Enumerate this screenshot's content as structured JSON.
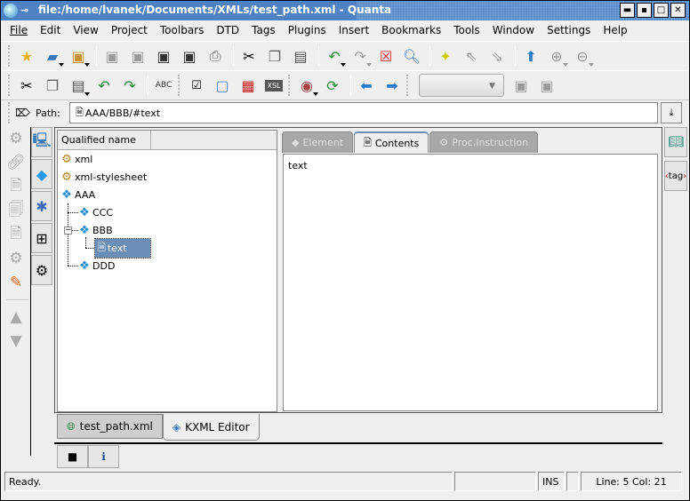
{
  "window": {
    "title": "file:/home/lvanek/Documents/XMLs/test_path.xml - Quanta",
    "buttons": [
      "minimize",
      "restore",
      "maximize",
      "close"
    ]
  },
  "menubar": {
    "items": [
      {
        "label": "File",
        "mnemonic": "F"
      },
      {
        "label": "Edit",
        "mnemonic": "E"
      },
      {
        "label": "View",
        "mnemonic": "V"
      },
      {
        "label": "Project",
        "mnemonic": "P"
      },
      {
        "label": "Toolbars",
        "mnemonic": "l"
      },
      {
        "label": "DTD",
        "mnemonic": "D"
      },
      {
        "label": "Tags",
        "mnemonic": "T"
      },
      {
        "label": "Plugins",
        "mnemonic": "g"
      },
      {
        "label": "Insert",
        "mnemonic": "I"
      },
      {
        "label": "Bookmarks",
        "mnemonic": "B"
      },
      {
        "label": "Tools",
        "mnemonic": "o"
      },
      {
        "label": "Window",
        "mnemonic": "W"
      },
      {
        "label": "Settings",
        "mnemonic": "S"
      },
      {
        "label": "Help",
        "mnemonic": "H"
      }
    ]
  },
  "toolbar1": {
    "buttons": [
      "new-file",
      "open-file",
      "open-recent",
      "save",
      "save-as",
      "save-all",
      "close-file",
      "print",
      "cut",
      "copy",
      "paste",
      "undo",
      "redo",
      "close-document",
      "find",
      "bookmark-toggle",
      "bookmark-prev",
      "bookmark-next",
      "up",
      "add-to-project",
      "remove-from-project"
    ]
  },
  "toolbar2": {
    "buttons": [
      "cut",
      "copy",
      "paste",
      "undo",
      "redo",
      "spellcheck",
      "validate-checkbox",
      "preview",
      "xsl-table",
      "xsl",
      "view-preview",
      "reload",
      "back",
      "forward",
      "save",
      "save-template"
    ],
    "spellcheck_label": "ABC",
    "xsl_label": "XSL",
    "combo_value": ""
  },
  "pathbar": {
    "label": "Path:",
    "value": "AAA/BBB/#text"
  },
  "tree": {
    "column_header": "Qualified name",
    "nodes": [
      {
        "label": "xml",
        "type": "processing-instruction",
        "depth": 0
      },
      {
        "label": "xml-stylesheet",
        "type": "processing-instruction",
        "depth": 0
      },
      {
        "label": "AAA",
        "type": "element",
        "depth": 0
      },
      {
        "label": "CCC",
        "type": "element",
        "depth": 1
      },
      {
        "label": "BBB",
        "type": "element",
        "depth": 1,
        "expanded": true
      },
      {
        "label": "text",
        "type": "text",
        "depth": 2,
        "selected": true
      },
      {
        "label": "DDD",
        "type": "element",
        "depth": 1
      }
    ]
  },
  "editor": {
    "tabs": [
      {
        "label": "Element",
        "active": false
      },
      {
        "label": "Contents",
        "active": true
      },
      {
        "label": "Proc.Instruction",
        "active": false
      }
    ],
    "contents_text": "text"
  },
  "right_sidebar": {
    "tag_label": "tag"
  },
  "document_tabs": [
    {
      "label": "test_path.xml",
      "active": false
    },
    {
      "label": "KXML Editor",
      "active": true
    }
  ],
  "statusbar": {
    "message": "Ready.",
    "mode": "INS",
    "position": "Line: 5 Col: 21"
  },
  "colors": {
    "title_bar": "#4f82c2",
    "selection": "#6a8eb5",
    "background": "#efefef"
  }
}
